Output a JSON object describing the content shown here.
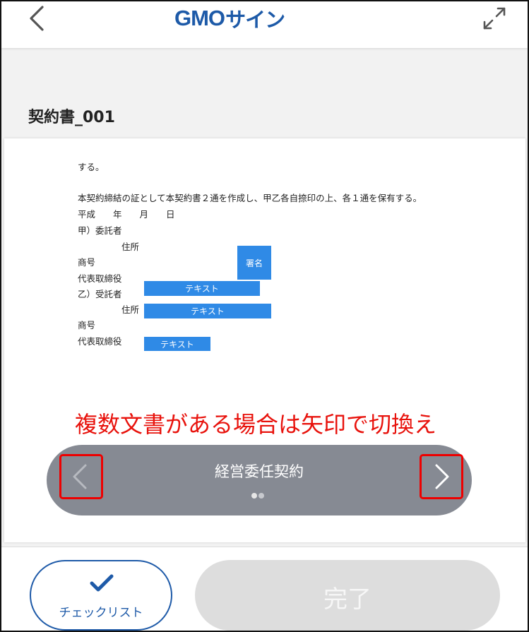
{
  "header": {
    "logo_en": "GMO",
    "logo_jp": "サイン",
    "brand_color": "#1d5aa8"
  },
  "document": {
    "title": "契約書_001",
    "lines": [
      "する。",
      "本契約締結の証として本契約書２通を作成し、甲乙各自捺印の上、各１通を保有する。",
      "平成　　年　　月　　日",
      "甲）委託者",
      "住所",
      "商号",
      "代表取締役",
      "乙）受託者",
      "住所",
      "商号",
      "代表取締役"
    ],
    "fields": {
      "signature": "署名",
      "text_1": "テキスト",
      "text_2": "テキスト",
      "text_3": "テキスト"
    },
    "field_color": "#2f8ae6"
  },
  "annotation": {
    "text": "複数文書がある場合は矢印で切換え",
    "color": "#e8120c"
  },
  "switcher": {
    "current_document": "経営委任契約",
    "page_count": 2,
    "current_index": 1,
    "background": "#868a93",
    "highlight_color": "#e00000",
    "prev_icon": "chevron-left-icon",
    "next_icon": "chevron-right-icon"
  },
  "footer": {
    "checklist_label": "チェックリスト",
    "checklist_icon": "checkmark-icon",
    "done_label": "完了"
  }
}
